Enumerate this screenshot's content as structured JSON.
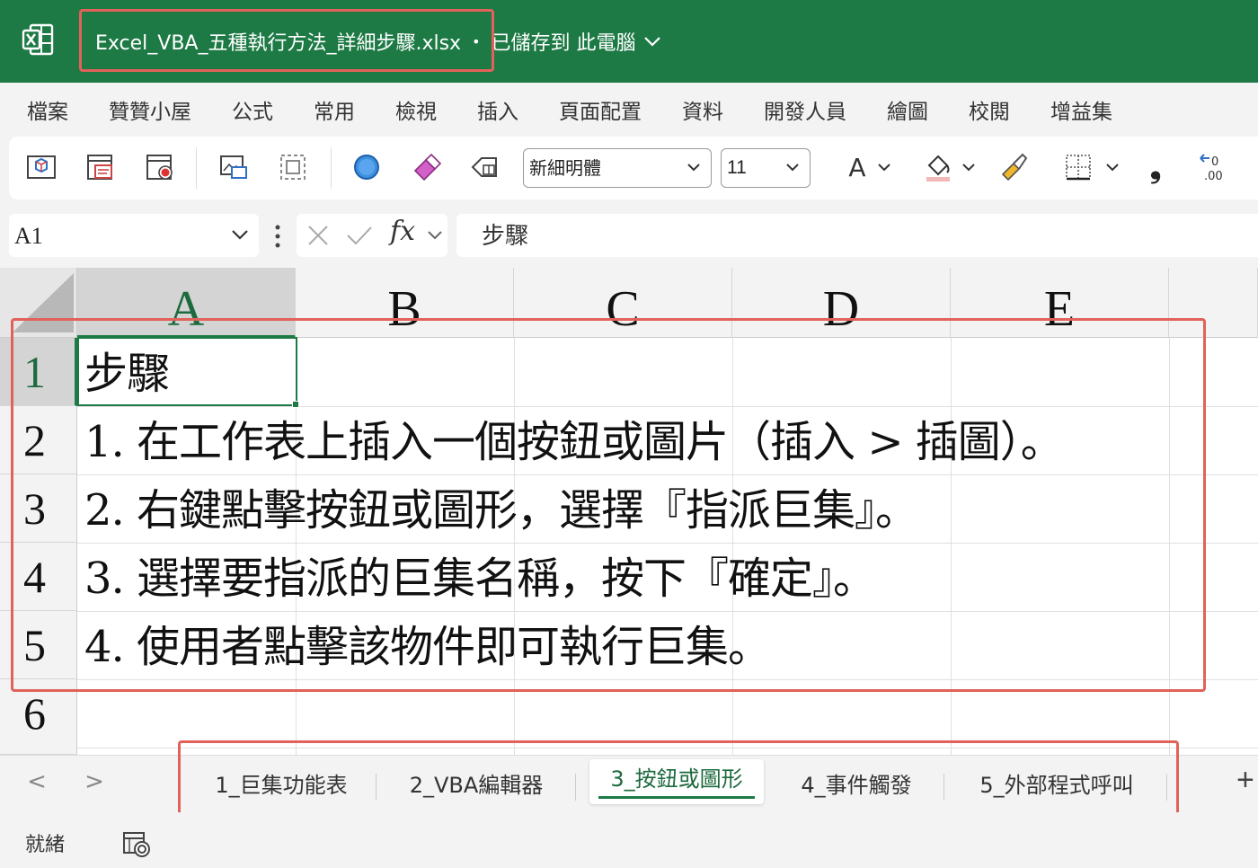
{
  "titlebar": {
    "filename": "Excel_VBA_五種執行方法_詳細步驟.xlsx",
    "separator": "•",
    "save_status": "已儲存到 此電腦",
    "app_icon": "excel-logo-icon",
    "accent": "#1d7a45"
  },
  "menu": {
    "items": [
      "檔案",
      "贊贊小屋",
      "公式",
      "常用",
      "檢視",
      "插入",
      "頁面配置",
      "資料",
      "開發人員",
      "繪圖",
      "校閱",
      "增益集"
    ]
  },
  "ribbon": {
    "font_name": "新細明體",
    "font_size": "11",
    "font_color_glyph": "A",
    "comma_glyph": "❟",
    "icons": [
      "3d-model-icon",
      "form-icon",
      "macro-record-icon",
      "picture-icon",
      "select-objects-icon",
      "circle-shape-icon",
      "eraser-icon",
      "clear-format-icon",
      "font-color-icon",
      "fill-color-icon",
      "format-painter-icon",
      "borders-icon",
      "comma-style-icon",
      "decrease-decimal-icon"
    ]
  },
  "formula_bar": {
    "name_box": "A1",
    "fx_label": "fx",
    "content": "步驟"
  },
  "grid": {
    "columns": [
      "A",
      "B",
      "C",
      "D",
      "E"
    ],
    "rows": [
      "1",
      "2",
      "3",
      "4",
      "5",
      "6"
    ],
    "cells": [
      "步驟",
      "1. 在工作表上插入一個按鈕或圖片（插入 > 插圖）。",
      "2. 右鍵點擊按鈕或圖形，選擇『指派巨集』。",
      "3. 選擇要指派的巨集名稱，按下『確定』。",
      "4. 使用者點擊該物件即可執行巨集。"
    ],
    "selected_cell": "A1"
  },
  "sheets": {
    "tabs": [
      "1_巨集功能表",
      "2_VBA編輯器",
      "3_按鈕或圖形",
      "4_事件觸發",
      "5_外部程式呼叫"
    ],
    "active_index": 2,
    "prev_glyph": "<",
    "next_glyph": ">",
    "add_glyph": "+"
  },
  "status": {
    "text": "就緒",
    "icon": "accessibility-icon"
  },
  "annotation_color": "#e0625a"
}
